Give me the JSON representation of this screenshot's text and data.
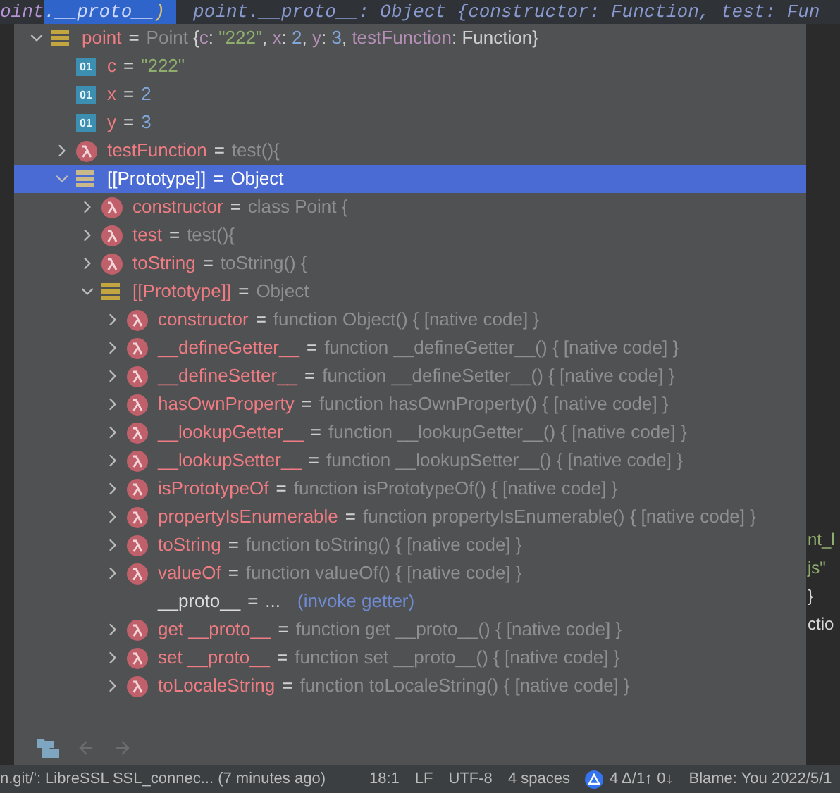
{
  "editor_top": {
    "code_prefix": "oint",
    "code_selected": ".__proto__",
    "code_suffix": ")",
    "hint": "point.__proto__: Object {constructor: Function, test: Fun"
  },
  "editor_right": [
    {
      "text": "nt_l",
      "kind": "string"
    },
    {
      "text": "js\"",
      "kind": "string"
    },
    {
      "text": "}",
      "kind": "plain"
    },
    {
      "text": "ctio",
      "kind": "plain"
    }
  ],
  "tree": [
    {
      "kind": "object",
      "name": "point",
      "op": "=",
      "expanded": true,
      "selected": false,
      "value": [
        {
          "text": "Point ",
          "kind": "dim"
        },
        {
          "text": "{",
          "kind": "plain"
        },
        {
          "text": "c",
          "kind": "key"
        },
        {
          "text": ": ",
          "kind": "plain"
        },
        {
          "text": "\"222\"",
          "kind": "string"
        },
        {
          "text": ", ",
          "kind": "plain"
        },
        {
          "text": "x",
          "kind": "key"
        },
        {
          "text": ": ",
          "kind": "plain"
        },
        {
          "text": "2",
          "kind": "number"
        },
        {
          "text": ", ",
          "kind": "plain"
        },
        {
          "text": "y",
          "kind": "key"
        },
        {
          "text": ": ",
          "kind": "plain"
        },
        {
          "text": "3",
          "kind": "number"
        },
        {
          "text": ", ",
          "kind": "plain"
        },
        {
          "text": "testFunction",
          "kind": "key"
        },
        {
          "text": ": Function}",
          "kind": "plain"
        }
      ],
      "children": [
        {
          "kind": "primitive",
          "badge": "01",
          "name": "c",
          "op": "=",
          "selected": false,
          "value": [
            {
              "text": "\"222\"",
              "kind": "string"
            }
          ]
        },
        {
          "kind": "primitive",
          "badge": "01",
          "name": "x",
          "op": "=",
          "selected": false,
          "value": [
            {
              "text": "2",
              "kind": "number"
            }
          ]
        },
        {
          "kind": "primitive",
          "badge": "01",
          "name": "y",
          "op": "=",
          "selected": false,
          "value": [
            {
              "text": "3",
              "kind": "number"
            }
          ]
        },
        {
          "kind": "function",
          "name": "testFunction",
          "op": "=",
          "expanded": false,
          "selected": false,
          "value": [
            {
              "text": "test(){",
              "kind": "dim"
            }
          ]
        },
        {
          "kind": "object",
          "name": "[[Prototype]]",
          "op": "=",
          "expanded": true,
          "selected": true,
          "value": [
            {
              "text": "Object",
              "kind": "dim"
            }
          ],
          "children": [
            {
              "kind": "function",
              "name": "constructor",
              "op": "=",
              "expanded": false,
              "selected": false,
              "value": [
                {
                  "text": "class Point {",
                  "kind": "dim"
                }
              ]
            },
            {
              "kind": "function",
              "name": "test",
              "op": "=",
              "expanded": false,
              "selected": false,
              "value": [
                {
                  "text": "test(){",
                  "kind": "dim"
                }
              ]
            },
            {
              "kind": "function",
              "name": "toString",
              "op": "=",
              "expanded": false,
              "selected": false,
              "value": [
                {
                  "text": "toString() {",
                  "kind": "dim"
                }
              ]
            },
            {
              "kind": "object",
              "name": "[[Prototype]]",
              "op": "=",
              "expanded": true,
              "selected": false,
              "value": [
                {
                  "text": "Object",
                  "kind": "dim"
                }
              ],
              "children": [
                {
                  "kind": "function",
                  "name": "constructor",
                  "op": "=",
                  "expanded": false,
                  "selected": false,
                  "value": [
                    {
                      "text": "function Object() { [native code] }",
                      "kind": "dim"
                    }
                  ]
                },
                {
                  "kind": "function",
                  "name": "__defineGetter__",
                  "op": "=",
                  "expanded": false,
                  "selected": false,
                  "value": [
                    {
                      "text": "function __defineGetter__() { [native code] }",
                      "kind": "dim"
                    }
                  ]
                },
                {
                  "kind": "function",
                  "name": "__defineSetter__",
                  "op": "=",
                  "expanded": false,
                  "selected": false,
                  "value": [
                    {
                      "text": "function __defineSetter__() { [native code] }",
                      "kind": "dim"
                    }
                  ]
                },
                {
                  "kind": "function",
                  "name": "hasOwnProperty",
                  "op": "=",
                  "expanded": false,
                  "selected": false,
                  "value": [
                    {
                      "text": "function hasOwnProperty() { [native code] }",
                      "kind": "dim"
                    }
                  ]
                },
                {
                  "kind": "function",
                  "name": "__lookupGetter__",
                  "op": "=",
                  "expanded": false,
                  "selected": false,
                  "value": [
                    {
                      "text": "function __lookupGetter__() { [native code] }",
                      "kind": "dim"
                    }
                  ]
                },
                {
                  "kind": "function",
                  "name": "__lookupSetter__",
                  "op": "=",
                  "expanded": false,
                  "selected": false,
                  "value": [
                    {
                      "text": "function __lookupSetter__() { [native code] }",
                      "kind": "dim"
                    }
                  ]
                },
                {
                  "kind": "function",
                  "name": "isPrototypeOf",
                  "op": "=",
                  "expanded": false,
                  "selected": false,
                  "value": [
                    {
                      "text": "function isPrototypeOf() { [native code] }",
                      "kind": "dim"
                    }
                  ]
                },
                {
                  "kind": "function",
                  "name": "propertyIsEnumerable",
                  "op": "=",
                  "expanded": false,
                  "selected": false,
                  "value": [
                    {
                      "text": "function propertyIsEnumerable() { [native code] }",
                      "kind": "dim"
                    }
                  ]
                },
                {
                  "kind": "function",
                  "name": "toString",
                  "op": "=",
                  "expanded": false,
                  "selected": false,
                  "value": [
                    {
                      "text": "function toString() { [native code] }",
                      "kind": "dim"
                    }
                  ]
                },
                {
                  "kind": "function",
                  "name": "valueOf",
                  "op": "=",
                  "expanded": false,
                  "selected": false,
                  "value": [
                    {
                      "text": "function valueOf() { [native code] }",
                      "kind": "dim"
                    }
                  ]
                },
                {
                  "kind": "getter",
                  "name": "__proto__",
                  "op": "=",
                  "selected": false,
                  "value": [
                    {
                      "text": "...",
                      "kind": "plain"
                    }
                  ],
                  "link": "(invoke getter)"
                },
                {
                  "kind": "function",
                  "name": "get __proto__",
                  "op": "=",
                  "expanded": false,
                  "selected": false,
                  "value": [
                    {
                      "text": "function get __proto__() { [native code] }",
                      "kind": "dim"
                    }
                  ]
                },
                {
                  "kind": "function",
                  "name": "set __proto__",
                  "op": "=",
                  "expanded": false,
                  "selected": false,
                  "value": [
                    {
                      "text": "function set __proto__() { [native code] }",
                      "kind": "dim"
                    }
                  ]
                },
                {
                  "kind": "function",
                  "name": "toLocaleString",
                  "op": "=",
                  "expanded": false,
                  "selected": false,
                  "value": [
                    {
                      "text": "function toLocaleString() { [native code] }",
                      "kind": "dim"
                    }
                  ]
                }
              ]
            }
          ]
        }
      ]
    }
  ],
  "status_bar": {
    "message": "n.git/': LibreSSL SSL_connec... (7 minutes ago)",
    "position": "18:1",
    "line_ending": "LF",
    "encoding": "UTF-8",
    "indent": "4 spaces",
    "vcs": "4 Δ/1↑ 0↓",
    "blame": "Blame: You 2022/5/1"
  }
}
